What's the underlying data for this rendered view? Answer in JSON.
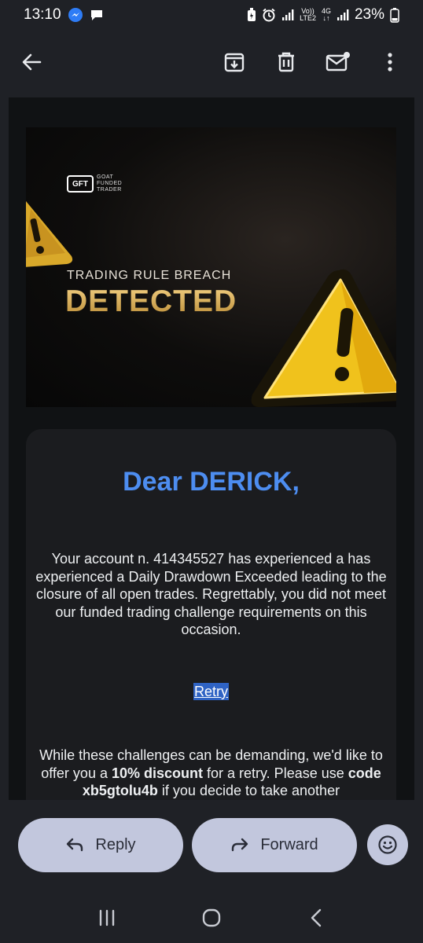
{
  "status_bar": {
    "time": "13:10",
    "volte_top": "Vo))",
    "volte_bottom": "LTE2",
    "network_top": "4G",
    "battery": "23%"
  },
  "email": {
    "banner": {
      "logo_mark": "GFT",
      "logo_line1": "GOAT",
      "logo_line2": "FUNDED",
      "logo_line3": "TRADER",
      "subtitle": "TRADING RULE BREACH",
      "title": "DETECTED"
    },
    "greeting": "Dear DERICK,",
    "paragraph1": "Your account n. 414345527 has experienced a has experienced a Daily Drawdown Exceeded leading to the closure of all open trades. Regrettably, you did not meet our funded trading challenge requirements on this occasion.",
    "retry_link": "Retry",
    "paragraph2_part1": "While these challenges can be demanding, we'd like to offer you a ",
    "paragraph2_bold1": "10% discount",
    "paragraph2_part2": " for a retry. Please use ",
    "paragraph2_bold2": "code xb5gtolu4b",
    "paragraph2_part3": " if you decide to take another"
  },
  "actions": {
    "reply_label": "Reply",
    "forward_label": "Forward"
  },
  "colors": {
    "accent_blue": "#4d8df0",
    "pill_bg": "#c2c7dd",
    "gold": "#e2b454"
  }
}
